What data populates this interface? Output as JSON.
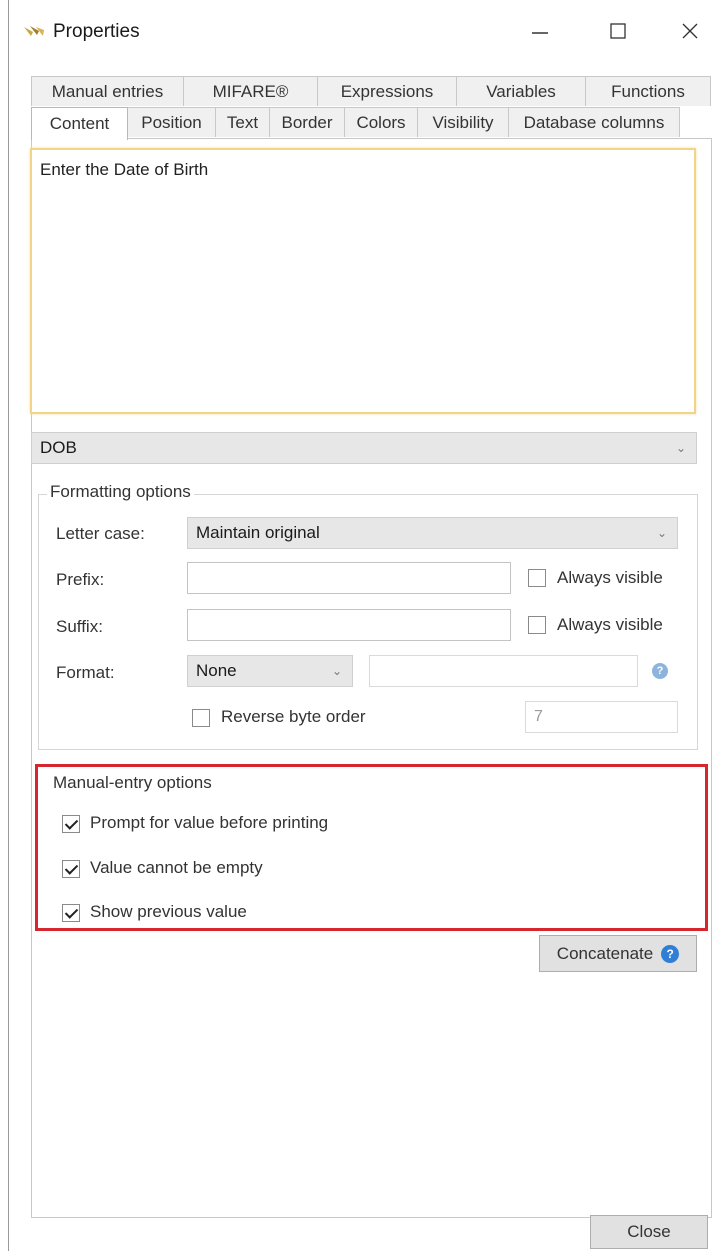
{
  "window": {
    "title": "Properties",
    "icon": "properties-app-icon"
  },
  "tabs_row1": [
    "Manual entries",
    "MIFARE®",
    "Expressions",
    "Variables",
    "Functions"
  ],
  "tabs_row2": [
    "Content",
    "Position",
    "Text",
    "Border",
    "Colors",
    "Visibility",
    "Database columns"
  ],
  "active_tab": "Content",
  "content": {
    "text_value": "Enter the Date of Birth",
    "field_dropdown": "DOB"
  },
  "formatting": {
    "legend": "Formatting options",
    "letter_case_label": "Letter case:",
    "letter_case_value": "Maintain original",
    "prefix_label": "Prefix:",
    "prefix_value": "",
    "prefix_always_visible": "Always visible",
    "suffix_label": "Suffix:",
    "suffix_value": "",
    "suffix_always_visible": "Always visible",
    "format_label": "Format:",
    "format_value": "None",
    "reverse_byte_order_label": "Reverse byte order",
    "byte_count_value": "7"
  },
  "manual_entry": {
    "legend": "Manual-entry options",
    "prompt_label": "Prompt for value before printing",
    "prompt_checked": true,
    "not_empty_label": "Value cannot be empty",
    "not_empty_checked": true,
    "show_previous_label": "Show previous value",
    "show_previous_checked": true
  },
  "buttons": {
    "concatenate": "Concatenate",
    "close": "Close"
  },
  "colors": {
    "highlight_border": "#d62630",
    "focus_border": "#f0d48a"
  }
}
